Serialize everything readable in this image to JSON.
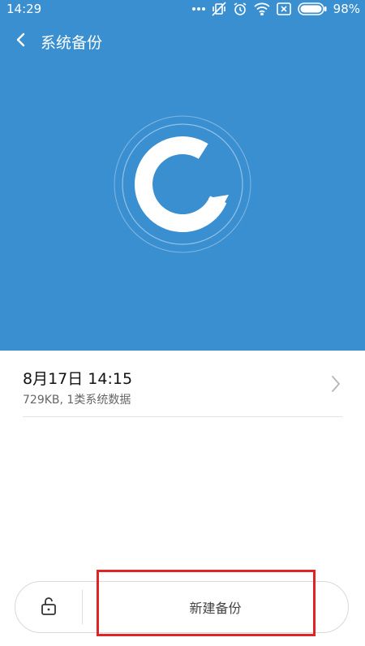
{
  "status_bar": {
    "time": "14:29",
    "icons": [
      "more-dots-icon",
      "vibrate-off-icon",
      "alarm-icon",
      "wifi-icon",
      "sim-x-icon",
      "battery-icon"
    ],
    "battery_percent": "98%"
  },
  "header": {
    "title": "系统备份",
    "back_icon": "chevron-left-icon"
  },
  "hero": {
    "background_color": "#3a8fd1",
    "logo_icon": "backup-logo-icon"
  },
  "backup_list": [
    {
      "title": "8月17日 14:15",
      "subtitle": "729KB, 1类系统数据"
    }
  ],
  "bottom_bar": {
    "lock_icon": "unlock-icon",
    "new_backup_label": "新建备份"
  },
  "annotation": {
    "highlight_color": "#e02424"
  }
}
